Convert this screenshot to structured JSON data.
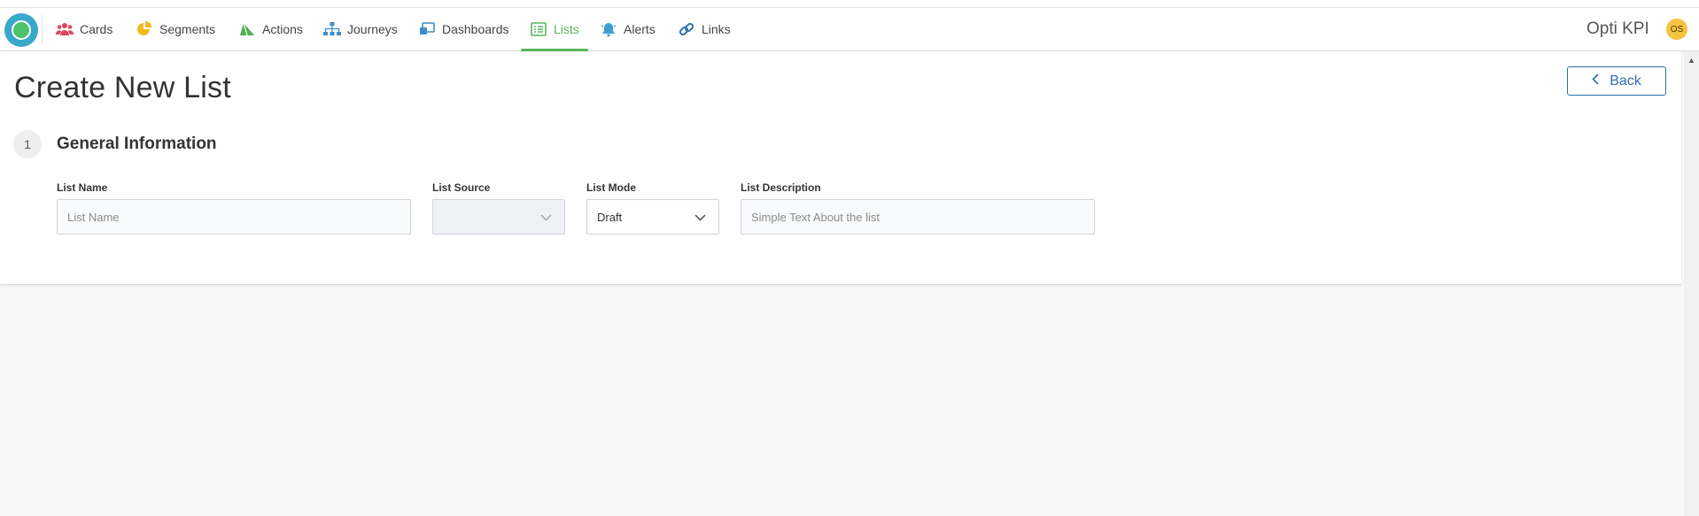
{
  "nav": {
    "items": [
      {
        "label": "Cards",
        "icon": "users-icon",
        "active": false
      },
      {
        "label": "Segments",
        "icon": "pie-chart-icon",
        "active": false
      },
      {
        "label": "Actions",
        "icon": "send-icon",
        "active": false
      },
      {
        "label": "Journeys",
        "icon": "sitemap-icon",
        "active": false
      },
      {
        "label": "Dashboards",
        "icon": "dashboard-icon",
        "active": false
      },
      {
        "label": "Lists",
        "icon": "list-icon",
        "active": true
      },
      {
        "label": "Alerts",
        "icon": "bell-icon",
        "active": false
      },
      {
        "label": "Links",
        "icon": "link-icon",
        "active": false
      }
    ],
    "brand": "Opti KPI",
    "avatar_initials": "OS"
  },
  "page": {
    "title": "Create New List",
    "back_label": "Back"
  },
  "section": {
    "step": "1",
    "title": "General Information"
  },
  "form": {
    "list_name": {
      "label": "List Name",
      "placeholder": "List Name",
      "value": ""
    },
    "list_source": {
      "label": "List Source",
      "value": ""
    },
    "list_mode": {
      "label": "List Mode",
      "value": "Draft"
    },
    "list_description": {
      "label": "List Description",
      "placeholder": "Simple Text About the list",
      "value": ""
    }
  },
  "colors": {
    "accent_active": "#5bb55a",
    "back_button": "#2b6fae",
    "avatar": "#f5c242",
    "logo": "#3aa8c8",
    "cards_icon": "#e0445a",
    "segments_icon": "#f3b81d",
    "actions_icon": "#4caf50",
    "journeys_icon": "#3d8ec9",
    "dashboards_icon": "#3d8ec9",
    "alerts_icon": "#3aa0d0",
    "links_icon": "#2b6fae"
  }
}
